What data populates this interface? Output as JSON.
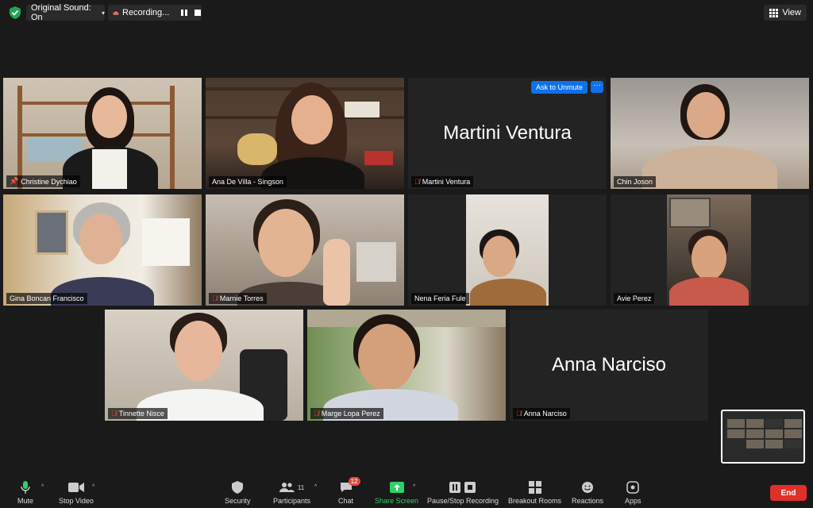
{
  "topbar": {
    "original_sound": "Original Sound: On",
    "recording": "Recording...",
    "view": "View"
  },
  "participants": [
    {
      "name": "Christine Dychiao",
      "muted": false,
      "pinned": true,
      "active": true
    },
    {
      "name": "Ana De Villa - Singson",
      "muted": false
    },
    {
      "name": "Martini Ventura",
      "muted": true,
      "video": false,
      "ask_to_unmute": "Ask to Unmute",
      "more": "···"
    },
    {
      "name": "Chin Joson",
      "muted": false
    },
    {
      "name": "Gina Boncan Francisco",
      "muted": false
    },
    {
      "name": "Marnie Torres",
      "muted": true
    },
    {
      "name": "Nena Feria Fule",
      "muted": false
    },
    {
      "name": "Avie Perez",
      "muted": false
    },
    {
      "name": "Tinnette Nisce",
      "muted": true
    },
    {
      "name": "Marge Lopa Perez",
      "muted": true
    },
    {
      "name": "Anna Narciso",
      "muted": true,
      "video": false
    }
  ],
  "toolbar": {
    "mute": "Mute",
    "stop_video": "Stop Video",
    "security": "Security",
    "participants": "Participants",
    "participants_count": "11",
    "chat": "Chat",
    "chat_badge": "12",
    "share_screen": "Share Screen",
    "recording": "Pause/Stop Recording",
    "breakout": "Breakout Rooms",
    "reactions": "Reactions",
    "apps": "Apps",
    "end": "End"
  },
  "colors": {
    "accent_blue": "#0e71eb",
    "share_green": "#2fd069",
    "end_red": "#e0302b",
    "active_outline": "#e6e58c",
    "muted_red": "#e0483e"
  }
}
